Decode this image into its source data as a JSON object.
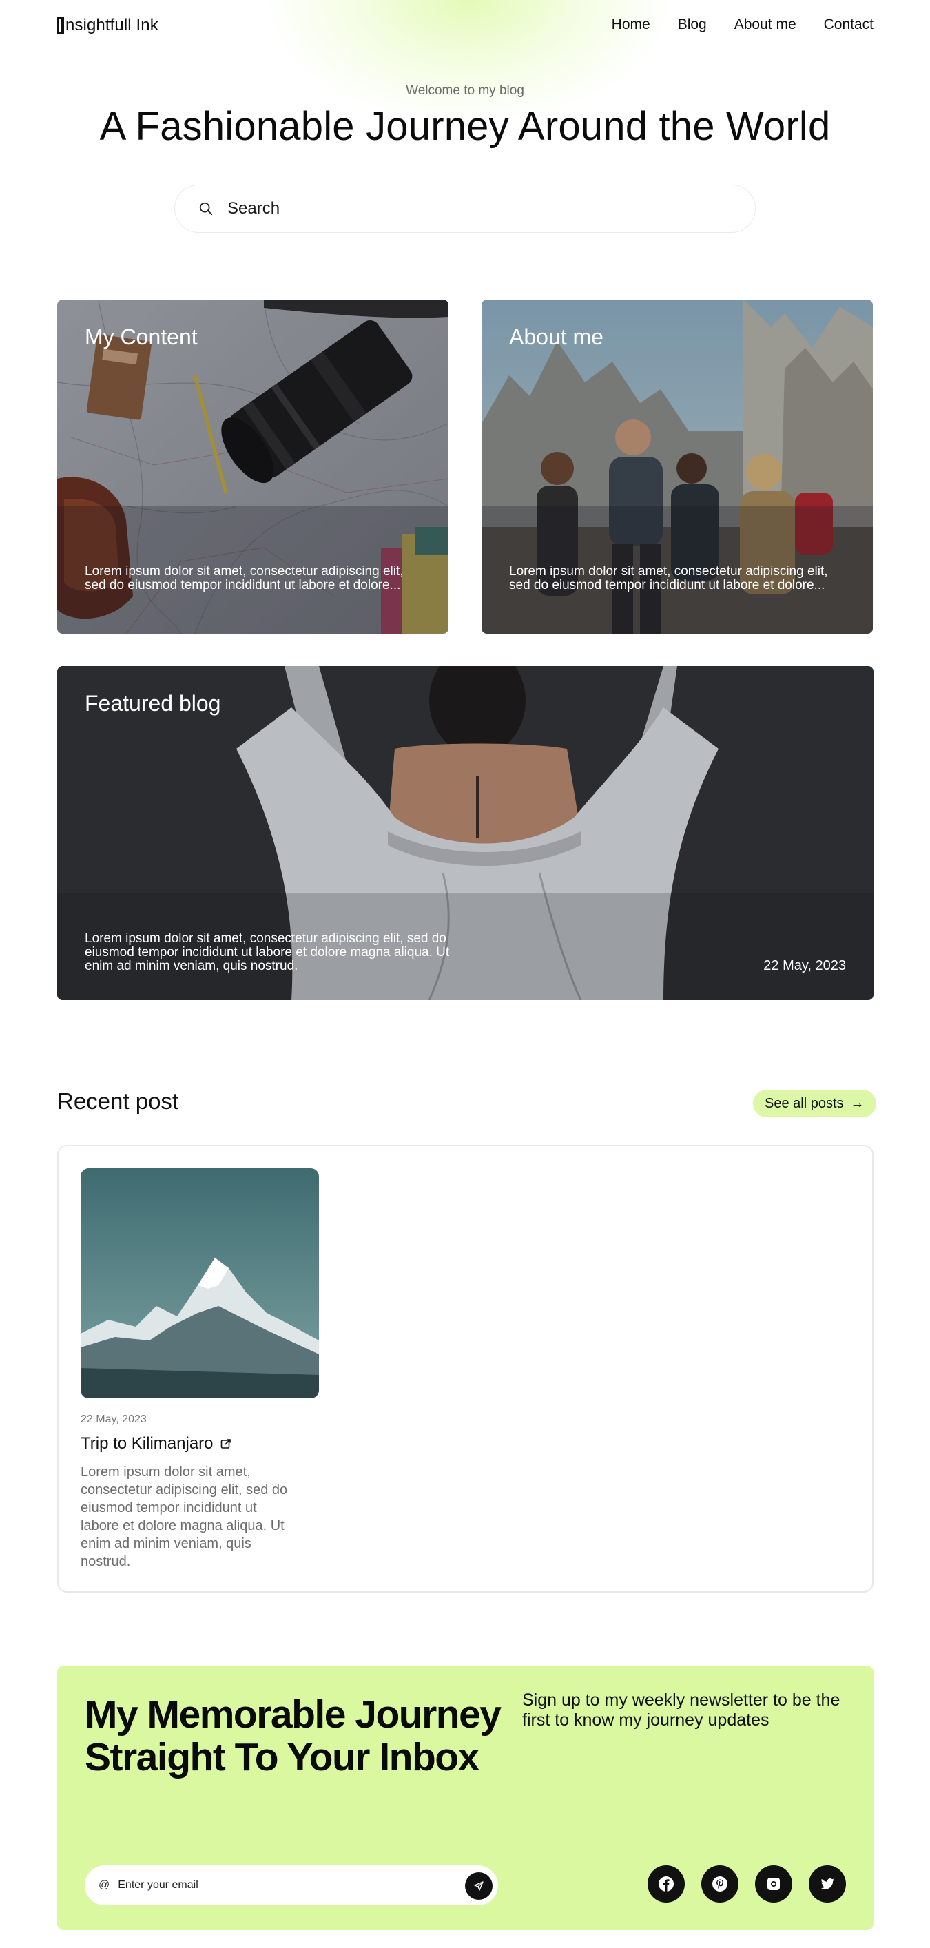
{
  "header": {
    "logo_text": "nsightfull Ink",
    "nav": [
      "Home",
      "Blog",
      "About me",
      "Contact"
    ]
  },
  "hero": {
    "eyebrow": "Welcome to my blog",
    "title": "A Fashionable Journey Around the World",
    "search_placeholder": "Search"
  },
  "cards": {
    "content": {
      "title": "My Content",
      "description": "Lorem ipsum dolor sit amet, consectetur adipiscing elit, sed do eiusmod tempor incididunt ut labore et dolore..."
    },
    "about": {
      "title": "About me",
      "description": "Lorem ipsum dolor sit amet, consectetur adipiscing elit, sed do eiusmod tempor incididunt ut labore et dolore..."
    },
    "featured": {
      "title": "Featured blog",
      "description": "Lorem ipsum dolor sit amet, consectetur adipiscing elit, sed do eiusmod tempor incididunt ut labore et dolore magna aliqua. Ut enim ad minim veniam, quis nostrud.",
      "date": "22 May, 2023"
    }
  },
  "recent": {
    "title": "Recent post",
    "see_all": "See all posts",
    "see_all_arrow": "→",
    "post": {
      "date": "22 May, 2023",
      "title": "Trip to Kilimanjaro",
      "description": "Lorem ipsum dolor sit amet, consectetur adipiscing elit, sed do eiusmod tempor incididunt ut labore et dolore magna aliqua. Ut enim ad minim veniam, quis nostrud."
    }
  },
  "newsletter": {
    "title": "My Memorable Journey Straight To Your Inbox",
    "subtitle": "Sign up to my weekly newsletter to be the first to know my journey updates",
    "email_placeholder": "Enter your email",
    "email_icon": "@",
    "socials": [
      "facebook-icon",
      "pinterest-icon",
      "instagram-icon",
      "twitter-icon"
    ]
  },
  "colors": {
    "accent": "#d9f8a0",
    "pill": "#dcf7a5",
    "dark": "#111111"
  }
}
